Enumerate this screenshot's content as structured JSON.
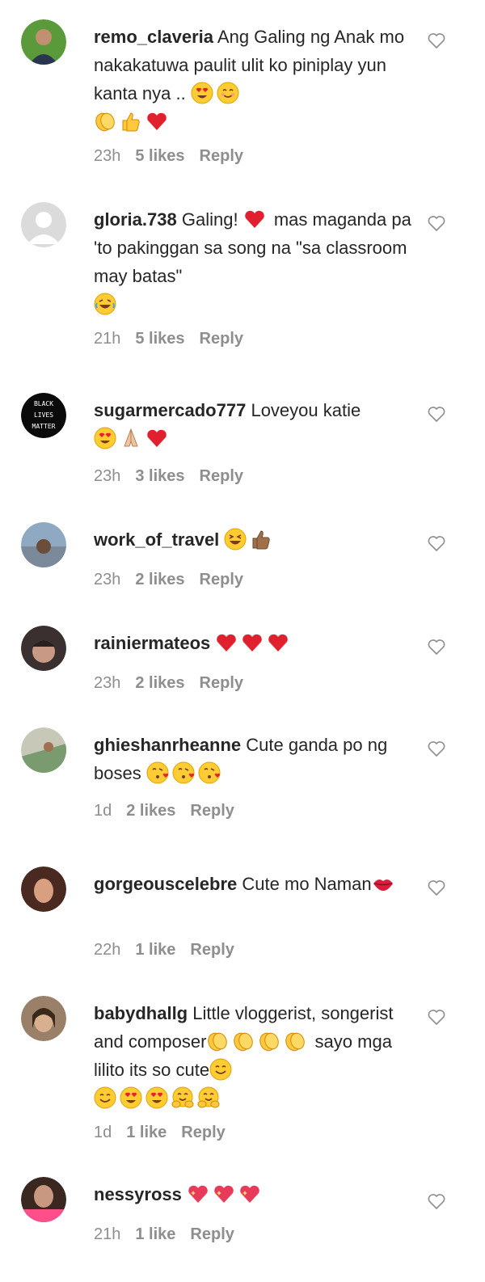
{
  "comments": [
    {
      "username": "remo_claveria",
      "text": "Ang Galing ng Anak mo nakakatuwa paulit ulit ko piniplay yun kanta nya ..",
      "emojis": [
        "heart-eyes",
        "smile",
        "clap",
        "thumbs-up",
        "heart"
      ],
      "time": "23h",
      "likes": "5 likes",
      "reply": "Reply",
      "avatar_colors": [
        "#5a9a3a",
        "#2a3550"
      ]
    },
    {
      "username": "gloria.738",
      "text": "Galing!",
      "text2": "mas maganda pa 'to pakinggan sa song na \"sa classroom may batas\"",
      "emojis_mid": [
        "heart"
      ],
      "emojis": [
        "laugh"
      ],
      "time": "21h",
      "likes": "5 likes",
      "reply": "Reply",
      "avatar_colors": [
        "#dbdbdb",
        "#ffffff"
      ]
    },
    {
      "username": "sugarmercado777",
      "text": "Loveyou katie",
      "emojis": [
        "heart-eyes",
        "pray",
        "heart"
      ],
      "time": "23h",
      "likes": "3 likes",
      "reply": "Reply",
      "avatar_label": [
        "BLACK",
        "LIVES",
        "MATTER"
      ]
    },
    {
      "username": "work_of_travel",
      "text": "",
      "emojis": [
        "grin-squint",
        "thumbs-up-dark"
      ],
      "time": "23h",
      "likes": "2 likes",
      "reply": "Reply",
      "avatar_colors": [
        "#8fa9c2",
        "#6b4e3a"
      ]
    },
    {
      "username": "rainiermateos",
      "text": "",
      "emojis": [
        "heart",
        "heart",
        "heart"
      ],
      "time": "23h",
      "likes": "2 likes",
      "reply": "Reply",
      "avatar_colors": [
        "#3a3030",
        "#c89a86"
      ]
    },
    {
      "username": "ghieshanrheanne",
      "text": "Cute ganda po ng boses",
      "emojis": [
        "kiss-heart",
        "kiss-heart",
        "kiss-heart"
      ],
      "time": "1d",
      "likes": "2 likes",
      "reply": "Reply",
      "avatar_colors": [
        "#7a9a70",
        "#c8c8b8"
      ]
    },
    {
      "username": "gorgeouscelebre",
      "text": "Cute mo Naman",
      "emojis": [
        "lips"
      ],
      "time": "22h",
      "likes": "1 like",
      "reply": "Reply",
      "avatar_colors": [
        "#4a2a20",
        "#d8a080"
      ]
    },
    {
      "username": "babydhallg",
      "text": "Little vloggerist, songerist and composer",
      "text2": "sayo mga lilito its so cute",
      "emojis": [
        "smile",
        "heart-eyes",
        "heart-eyes",
        "hug",
        "hug"
      ],
      "time": "1d",
      "likes": "1 like",
      "reply": "Reply",
      "avatar_colors": [
        "#9a8068",
        "#d8b090"
      ]
    },
    {
      "username": "nessyross",
      "text": "",
      "emojis": [
        "sparkle-heart",
        "sparkle-heart",
        "sparkle-heart"
      ],
      "time": "21h",
      "likes": "1 like",
      "reply": "Reply",
      "avatar_colors": [
        "#ff4f8b",
        "#3a2820"
      ]
    }
  ]
}
